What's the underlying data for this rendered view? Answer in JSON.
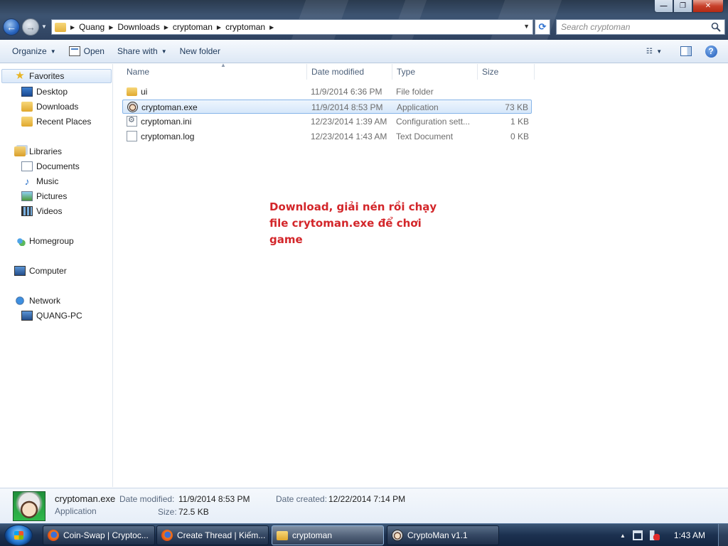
{
  "window": {
    "minimize_glyph": "—",
    "maximize_glyph": "❐",
    "close_glyph": "✕"
  },
  "address": {
    "crumbs": [
      "Quang",
      "Downloads",
      "cryptoman",
      "cryptoman"
    ],
    "search_placeholder": "Search cryptoman"
  },
  "toolbar": {
    "organize_label": "Organize",
    "open_label": "Open",
    "share_label": "Share with",
    "new_folder_label": "New folder"
  },
  "nav": {
    "favorites": "Favorites",
    "desktop": "Desktop",
    "downloads": "Downloads",
    "recent": "Recent Places",
    "libraries": "Libraries",
    "documents": "Documents",
    "music": "Music",
    "pictures": "Pictures",
    "videos": "Videos",
    "homegroup": "Homegroup",
    "computer": "Computer",
    "network": "Network",
    "pc": "QUANG-PC"
  },
  "columns": {
    "name": "Name",
    "date": "Date modified",
    "type": "Type",
    "size": "Size"
  },
  "files": [
    {
      "name": "ui",
      "date": "11/9/2014 6:36 PM",
      "type": "File folder",
      "size": ""
    },
    {
      "name": "cryptoman.exe",
      "date": "11/9/2014 8:53 PM",
      "type": "Application",
      "size": "73 KB"
    },
    {
      "name": "cryptoman.ini",
      "date": "12/23/2014 1:39 AM",
      "type": "Configuration sett...",
      "size": "1 KB"
    },
    {
      "name": "cryptoman.log",
      "date": "12/23/2014 1:43 AM",
      "type": "Text Document",
      "size": "0 KB"
    }
  ],
  "annotation": "Download, giải nén rồi chạy file crytoman.exe để chơi game",
  "details": {
    "name": "cryptoman.exe",
    "type": "Application",
    "modified_label": "Date modified:",
    "modified_value": "11/9/2014 8:53 PM",
    "size_label": "Size:",
    "size_value": "72.5 KB",
    "created_label": "Date created:",
    "created_value": "12/22/2014 7:14 PM"
  },
  "taskbar": {
    "tasks": [
      "Coin-Swap | Cryptoc...",
      "Create Thread | Kiếm...",
      "cryptoman",
      "CryptoMan v1.1"
    ],
    "clock": "1:43 AM"
  }
}
